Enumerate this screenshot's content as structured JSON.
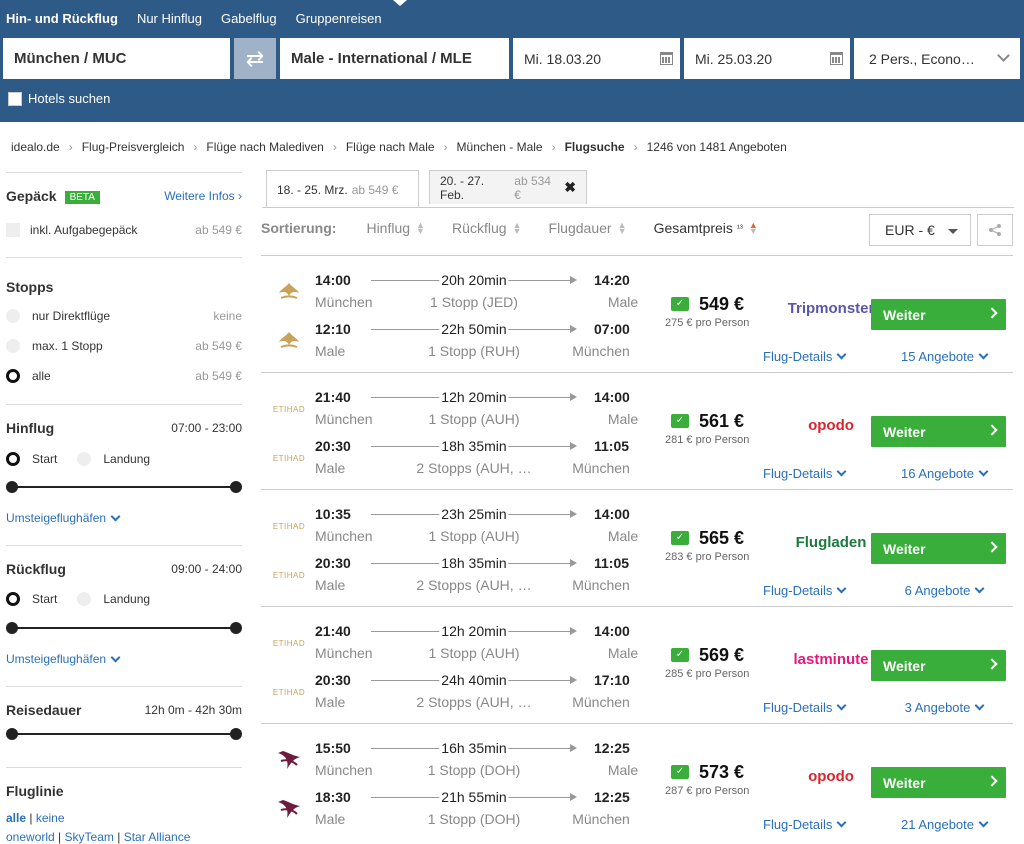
{
  "header": {
    "modes": [
      "Hin- und Rückflug",
      "Nur Hinflug",
      "Gabelflug",
      "Gruppenreisen"
    ],
    "origin": "München / MUC",
    "destination": "Male - International / MLE",
    "depart_date": "Mi. 18.03.20",
    "return_date": "Mi. 25.03.20",
    "passengers": "2 Pers., Econo…",
    "hotels_label": "Hotels suchen"
  },
  "breadcrumb": {
    "items": [
      "idealo.de",
      "Flug-Preisvergleich",
      "Flüge nach Malediven",
      "Flüge nach Male",
      "München - Male",
      "Flugsuche"
    ],
    "count": "1246 von 1481 Angeboten"
  },
  "sidebar": {
    "baggage": {
      "title": "Gepäck",
      "badge": "BETA",
      "more": "Weitere Infos ›",
      "opt_label": "inkl. Aufgabegepäck",
      "opt_price": "ab 549 €"
    },
    "stops": {
      "title": "Stopps",
      "options": [
        {
          "label": "nur Direktflüge",
          "price": "keine"
        },
        {
          "label": "max. 1 Stopp",
          "price": "ab 549 €"
        },
        {
          "label": "alle",
          "price": "ab 549 €"
        }
      ]
    },
    "outbound": {
      "title": "Hinflug",
      "range": "07:00 - 23:00",
      "start": "Start",
      "landing": "Landung",
      "transfer": "Umsteigeflughäfen"
    },
    "return": {
      "title": "Rückflug",
      "range": "09:00 - 24:00",
      "start": "Start",
      "landing": "Landung",
      "transfer": "Umsteigeflughäfen"
    },
    "duration": {
      "title": "Reisedauer",
      "range": "12h 0m - 42h 30m"
    },
    "airline": {
      "title": "Fluglinie",
      "all": "alle",
      "none": "keine",
      "alliances": [
        "oneworld",
        "SkyTeam",
        "Star Alliance"
      ]
    }
  },
  "tabs": [
    {
      "dates": "18. - 25. Mrz.",
      "price": "ab 549 €"
    },
    {
      "dates": "20. - 27. Feb.",
      "price": "ab 534 €"
    }
  ],
  "sort": {
    "label": "Sortierung:",
    "items": [
      "Hinflug",
      "Rückflug",
      "Flugdauer",
      "Gesamtpreis"
    ],
    "sup": "¹³",
    "currency": "EUR - €"
  },
  "results": [
    {
      "airline": "saudia",
      "price": "549 €",
      "per_person": "275 € pro Person",
      "provider": "Tripmonster",
      "provider_color": "#5a56a8",
      "offers": "15 Angebote",
      "details": "Flug-Details",
      "button": "Weiter",
      "legs": [
        {
          "dep": "14:00",
          "arr": "14:20",
          "dur": "20h 20min",
          "from": "München",
          "to": "Male",
          "stops": "1 Stopp (JED)"
        },
        {
          "dep": "12:10",
          "arr": "07:00",
          "dur": "22h 50min",
          "from": "Male",
          "to": "München",
          "stops": "1 Stopp (RUH)"
        }
      ]
    },
    {
      "airline": "etihad",
      "price": "561 €",
      "per_person": "281 € pro Person",
      "provider": "opodo",
      "provider_color": "#d8262e",
      "offers": "16 Angebote",
      "details": "Flug-Details",
      "button": "Weiter",
      "legs": [
        {
          "dep": "21:40",
          "arr": "14:00",
          "dur": "12h 20min",
          "from": "München",
          "to": "Male",
          "stops": "1 Stopp (AUH)"
        },
        {
          "dep": "20:30",
          "arr": "11:05",
          "dur": "18h 35min",
          "from": "Male",
          "to": "München",
          "stops": "2 Stopps (AUH, …"
        }
      ]
    },
    {
      "airline": "etihad",
      "price": "565 €",
      "per_person": "283 € pro Person",
      "provider": "Flugladen",
      "provider_color": "#1d7a3e",
      "offers": "6 Angebote",
      "details": "Flug-Details",
      "button": "Weiter",
      "legs": [
        {
          "dep": "10:35",
          "arr": "14:00",
          "dur": "23h 25min",
          "from": "München",
          "to": "Male",
          "stops": "1 Stopp (AUH)"
        },
        {
          "dep": "20:30",
          "arr": "11:05",
          "dur": "18h 35min",
          "from": "Male",
          "to": "München",
          "stops": "2 Stopps (AUH, …"
        }
      ]
    },
    {
      "airline": "etihad",
      "price": "569 €",
      "per_person": "285 € pro Person",
      "provider": "lastminute",
      "provider_color": "#e5197a",
      "offers": "3 Angebote",
      "details": "Flug-Details",
      "button": "Weiter",
      "legs": [
        {
          "dep": "21:40",
          "arr": "14:00",
          "dur": "12h 20min",
          "from": "München",
          "to": "Male",
          "stops": "1 Stopp (AUH)"
        },
        {
          "dep": "20:30",
          "arr": "17:10",
          "dur": "24h 40min",
          "from": "Male",
          "to": "München",
          "stops": "2 Stopps (AUH, …"
        }
      ]
    },
    {
      "airline": "qatar",
      "price": "573 €",
      "per_person": "287 € pro Person",
      "provider": "opodo",
      "provider_color": "#d8262e",
      "offers": "21 Angebote",
      "details": "Flug-Details",
      "button": "Weiter",
      "legs": [
        {
          "dep": "15:50",
          "arr": "12:25",
          "dur": "16h 35min",
          "from": "München",
          "to": "Male",
          "stops": "1 Stopp (DOH)"
        },
        {
          "dep": "18:30",
          "arr": "12:25",
          "dur": "21h 55min",
          "from": "Male",
          "to": "München",
          "stops": "1 Stopp (DOH)"
        }
      ]
    }
  ]
}
